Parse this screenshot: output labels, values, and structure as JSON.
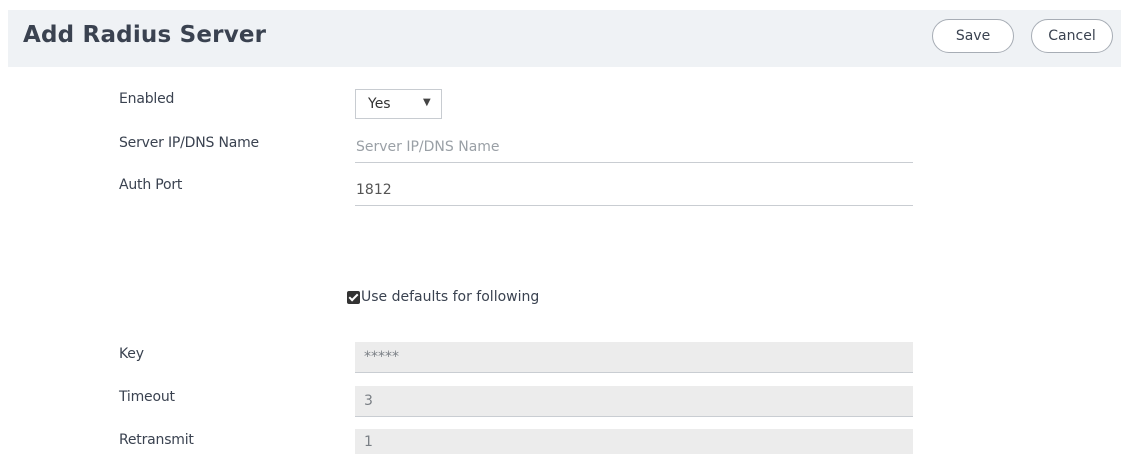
{
  "header": {
    "title": "Add Radius Server",
    "save_label": "Save",
    "cancel_label": "Cancel"
  },
  "form": {
    "enabled": {
      "label": "Enabled",
      "value": "Yes",
      "caret": "▼"
    },
    "server": {
      "label": "Server IP/DNS Name",
      "placeholder": "Server IP/DNS Name",
      "value": ""
    },
    "auth_port": {
      "label": "Auth Port",
      "value": "1812"
    },
    "use_defaults": {
      "label": "Use defaults for following",
      "checked": true
    },
    "key": {
      "label": "Key",
      "value": "*****"
    },
    "timeout": {
      "label": "Timeout",
      "value": "3"
    },
    "retransmit": {
      "label": "Retransmit",
      "value": "1"
    }
  }
}
